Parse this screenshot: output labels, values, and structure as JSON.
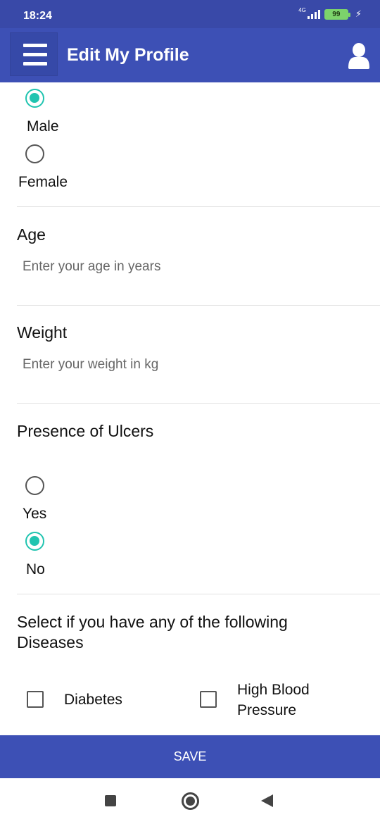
{
  "status": {
    "time": "18:24",
    "network": "4G",
    "battery": "99"
  },
  "app_bar": {
    "title": "Edit My Profile"
  },
  "gender": {
    "options": [
      {
        "label": "Male",
        "checked": true
      },
      {
        "label": "Female",
        "checked": false
      }
    ]
  },
  "age": {
    "label": "Age",
    "placeholder": "Enter your age in years",
    "value": ""
  },
  "weight": {
    "label": "Weight",
    "placeholder": "Enter your weight in kg",
    "value": ""
  },
  "ulcers": {
    "label": "Presence of Ulcers",
    "options": [
      {
        "label": "Yes",
        "checked": false
      },
      {
        "label": "No",
        "checked": true
      }
    ]
  },
  "diseases": {
    "label": "Select if you have any of the following Diseases",
    "options": [
      {
        "label": "Diabetes",
        "checked": false
      },
      {
        "label": "High Blood Pressure",
        "checked": false
      }
    ]
  },
  "save_label": "SAVE",
  "colors": {
    "primary": "#3d50b5",
    "status_bar": "#3949a8",
    "accent": "#20c4b0"
  }
}
